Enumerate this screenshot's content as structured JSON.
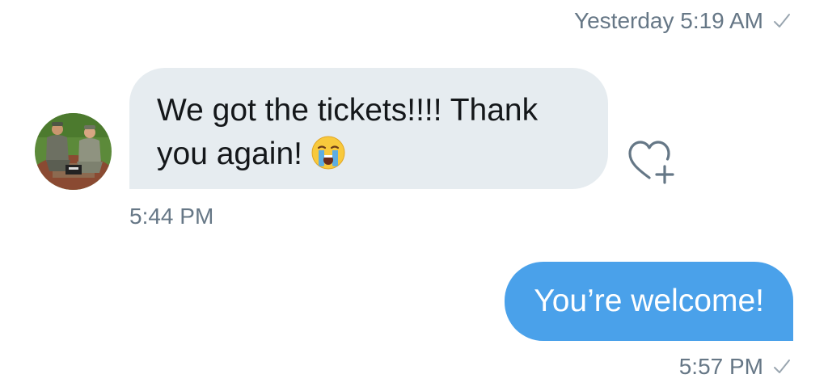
{
  "conversation": {
    "top_timestamp": "Yesterday 5:19 AM",
    "messages": [
      {
        "direction": "received",
        "text_line1": "We got the tickets!!!! Thank",
        "text_line2": "you again!",
        "emoji": "loudly-crying-face-icon",
        "timestamp": "5:44 PM"
      },
      {
        "direction": "sent",
        "text": "You’re welcome!",
        "timestamp": "5:57 PM"
      }
    ]
  },
  "icons": {
    "read_receipt": "checkmark-icon",
    "like": "heart-plus-icon",
    "avatar": "avatar-photo"
  },
  "colors": {
    "received_bubble": "#e6ecf0",
    "sent_bubble": "#4aa1ea",
    "timestamp_text": "#667786",
    "message_text": "#14171a"
  }
}
